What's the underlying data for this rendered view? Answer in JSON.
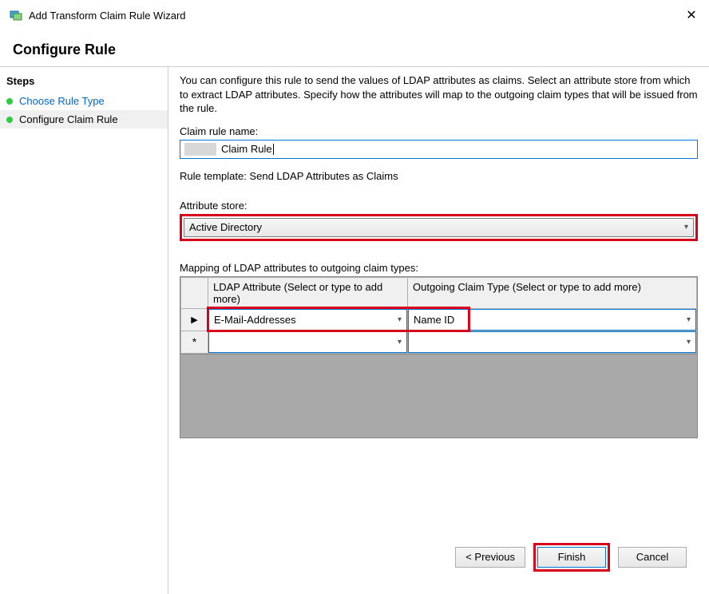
{
  "window": {
    "title": "Add Transform Claim Rule Wizard"
  },
  "page_heading": "Configure Rule",
  "sidebar": {
    "header": "Steps",
    "items": [
      {
        "label": "Choose Rule Type",
        "active": false
      },
      {
        "label": "Configure Claim Rule",
        "active": true
      }
    ]
  },
  "main": {
    "description": "You can configure this rule to send the values of LDAP attributes as claims. Select an attribute store from which to extract LDAP attributes. Specify how the attributes will map to the outgoing claim types that will be issued from the rule.",
    "rule_name_label": "Claim rule name:",
    "rule_name_value": "Claim Rule",
    "template_label": "Rule template: Send LDAP Attributes as Claims",
    "attribute_store_label": "Attribute store:",
    "attribute_store_value": "Active Directory",
    "mapping_label": "Mapping of LDAP attributes to outgoing claim types:",
    "table": {
      "ldap_header": "LDAP Attribute (Select or type to add more)",
      "claim_header": "Outgoing Claim Type (Select or type to add more)",
      "rows": [
        {
          "marker": "▶",
          "ldap": "E-Mail-Addresses",
          "claim": "Name ID"
        },
        {
          "marker": "*",
          "ldap": "",
          "claim": ""
        }
      ]
    }
  },
  "buttons": {
    "previous": "< Previous",
    "finish": "Finish",
    "cancel": "Cancel"
  }
}
